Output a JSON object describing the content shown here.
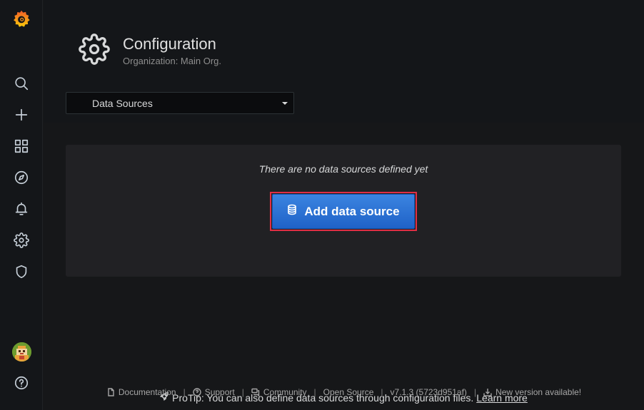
{
  "sidemenu": {
    "items": [
      {
        "icon": "grafana-logo-icon"
      },
      {
        "icon": "search-icon"
      },
      {
        "icon": "plus-icon"
      },
      {
        "icon": "dashboards-icon"
      },
      {
        "icon": "explore-icon"
      },
      {
        "icon": "alerting-bell-icon"
      },
      {
        "icon": "configuration-gear-icon"
      },
      {
        "icon": "server-admin-shield-icon"
      },
      {
        "icon": "user-avatar"
      },
      {
        "icon": "help-icon"
      }
    ],
    "brand_colors": [
      "#f05a28",
      "#fbca0a"
    ]
  },
  "header": {
    "title": "Configuration",
    "subtitle": "Organization: Main Org."
  },
  "nav_select": {
    "selected": "Data Sources"
  },
  "empty_state": {
    "title": "There are no data sources defined yet",
    "button_label": "Add data source",
    "protip_text": "ProTip: You can also define data sources through configuration files.",
    "protip_link": "Learn more"
  },
  "footer": {
    "documentation": "Documentation",
    "support": "Support",
    "community": "Community",
    "open_source": "Open Source",
    "version": "v7.1.3 (5723d951af)",
    "new_version": "New version available!",
    "separator": "|"
  },
  "colors": {
    "accent_blue": "#3274d9",
    "highlight_red": "#e02f44",
    "background": "#161719",
    "panel": "#212124"
  }
}
